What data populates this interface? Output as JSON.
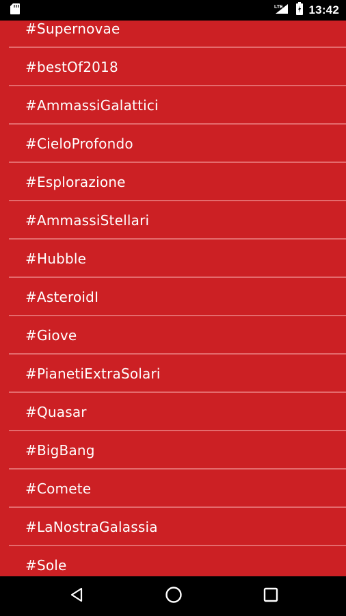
{
  "status_bar": {
    "time": "13:42",
    "network": "LTE",
    "icons": [
      "app-notification-icon",
      "signal-icon",
      "battery-icon"
    ]
  },
  "hashtags": [
    "#Supernovae",
    "#bestOf2018",
    "#AmmassiGalattici",
    "#CieloProfondo",
    "#Esplorazione",
    "#AmmassiStellari",
    "#Hubble",
    "#AsteroidI",
    "#Giove",
    "#PianetiExtraSolari",
    "#Quasar",
    "#BigBang",
    "#Comete",
    "#LaNostraGalassia",
    "#Sole"
  ],
  "nav_bar": {
    "buttons": [
      "back-icon",
      "home-icon",
      "recents-icon"
    ]
  },
  "colors": {
    "background": "#cc2024",
    "divider": "#e46b6d",
    "text": "#ffffff",
    "system_bars": "#000000"
  }
}
